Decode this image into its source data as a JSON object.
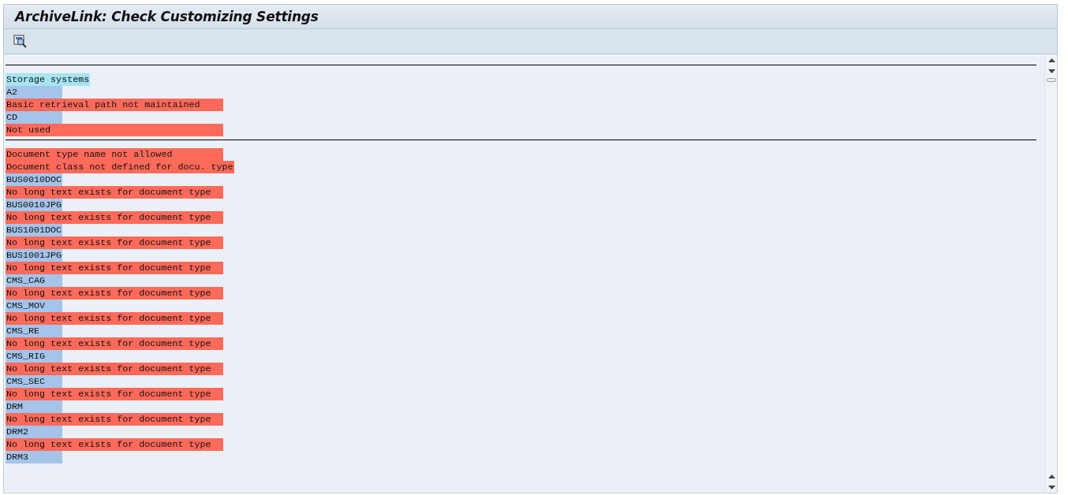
{
  "window": {
    "title": "ArchiveLink: Check Customizing Settings"
  },
  "sections": [
    {
      "lines": [
        {
          "text": "Storage systems",
          "kind": "header"
        },
        {
          "text": "A2",
          "kind": "key"
        },
        {
          "text": "Basic retrieval path not maintained",
          "kind": "error"
        },
        {
          "text": "CD",
          "kind": "key"
        },
        {
          "text": "Not used",
          "kind": "error"
        }
      ]
    },
    {
      "lines": [
        {
          "text": "Document type name not allowed",
          "kind": "error"
        },
        {
          "text": "Document class not defined for docu. type",
          "kind": "error"
        },
        {
          "text": "BUS0010DOC",
          "kind": "key"
        },
        {
          "text": "No long text exists for document type",
          "kind": "error"
        },
        {
          "text": "BUS0010JPG",
          "kind": "key"
        },
        {
          "text": "No long text exists for document type",
          "kind": "error"
        },
        {
          "text": "BUS1001DOC",
          "kind": "key"
        },
        {
          "text": "No long text exists for document type",
          "kind": "error"
        },
        {
          "text": "BUS1001JPG",
          "kind": "key"
        },
        {
          "text": "No long text exists for document type",
          "kind": "error"
        },
        {
          "text": "CMS_CAG",
          "kind": "key"
        },
        {
          "text": "No long text exists for document type",
          "kind": "error"
        },
        {
          "text": "CMS_MOV",
          "kind": "key"
        },
        {
          "text": "No long text exists for document type",
          "kind": "error"
        },
        {
          "text": "CMS_RE",
          "kind": "key"
        },
        {
          "text": "No long text exists for document type",
          "kind": "error"
        },
        {
          "text": "CMS_RIG",
          "kind": "key"
        },
        {
          "text": "No long text exists for document type",
          "kind": "error"
        },
        {
          "text": "CMS_SEC",
          "kind": "key"
        },
        {
          "text": "No long text exists for document type",
          "kind": "error"
        },
        {
          "text": "DRM",
          "kind": "key"
        },
        {
          "text": "No long text exists for document type",
          "kind": "error"
        },
        {
          "text": "DRM2",
          "kind": "key"
        },
        {
          "text": "No long text exists for document type",
          "kind": "error"
        },
        {
          "text": "DRM3",
          "kind": "key"
        }
      ]
    }
  ]
}
